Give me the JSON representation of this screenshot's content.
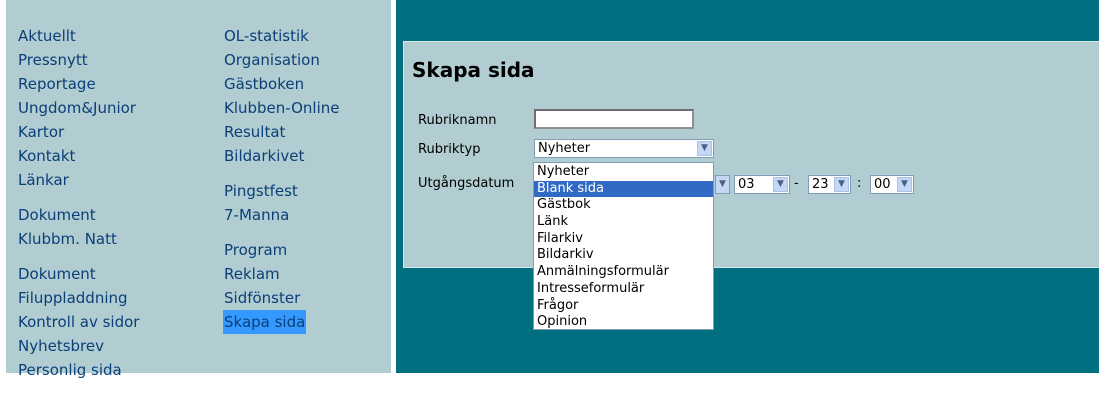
{
  "nav": {
    "col1": [
      [
        "Aktuellt",
        "Pressnytt",
        "Reportage",
        "Ungdom&Junior",
        "Kartor",
        "Kontakt",
        "Länkar"
      ],
      [
        "Dokument",
        "Klubbm. Natt"
      ],
      [
        "Dokument",
        "Filuppladdning",
        "Kontroll av sidor",
        "Nyhetsbrev",
        "Personlig sida"
      ]
    ],
    "col2": [
      [
        "OL-statistik",
        "Organisation",
        "Gästboken",
        "Klubben-Online",
        "Resultat",
        "Bildarkivet"
      ],
      [
        "Pingstfest",
        "7-Manna"
      ],
      [
        "Program",
        "Reklam",
        "Sidfönster",
        "Skapa sida"
      ]
    ],
    "active": "Skapa sida"
  },
  "form": {
    "title": "Skapa sida",
    "rubriknamn_label": "Rubriknamn",
    "rubriknamn_value": "",
    "rubriktyp_label": "Rubriktyp",
    "rubriktyp_value": "Nyheter",
    "utgangsdatum_label": "Utgångsdatum",
    "month": "03",
    "hour": "23",
    "minute": "00",
    "date_sep": "-",
    "time_sep": ":"
  },
  "dropdown": {
    "options": [
      "Nyheter",
      "Blank sida",
      "Gästbok",
      "Länk",
      "Filarkiv",
      "Bildarkiv",
      "Anmälningsformulär",
      "Intresseformulär",
      "Frågor",
      "Opinion"
    ],
    "highlighted_index": 1
  },
  "colors": {
    "nav_bg": "#b1cdd1",
    "content_bg": "#006f7f",
    "link": "#0b3f78",
    "active_highlight": "#3399ff",
    "option_highlight": "#316ac5"
  },
  "icons": {
    "select_arrow": "chevron-down-icon"
  }
}
